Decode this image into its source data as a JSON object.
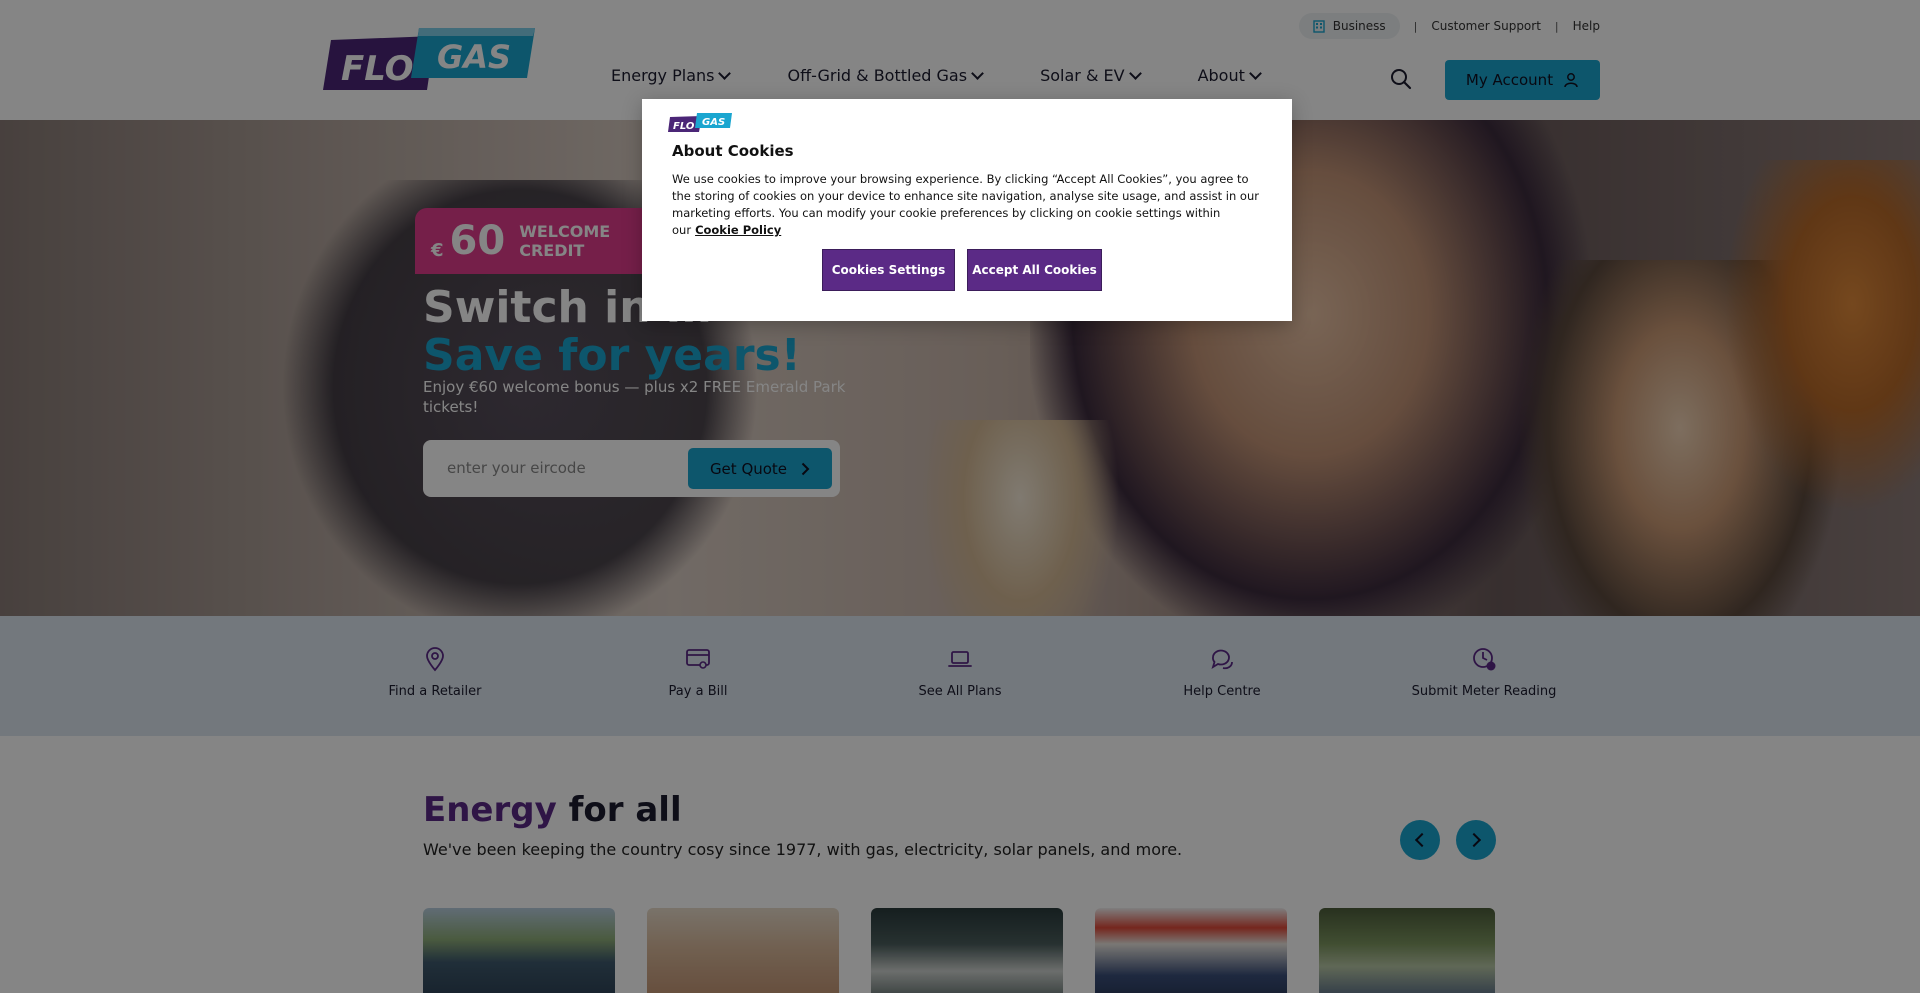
{
  "header": {
    "logo_text_left": "FLO",
    "logo_text_right": "GAS",
    "utility_links": [
      "Business",
      "Customer Support",
      "Help"
    ],
    "utility_separator": "|",
    "nav": [
      {
        "label": "Energy Plans"
      },
      {
        "label": "Off-Grid & Bottled Gas"
      },
      {
        "label": "Solar & EV"
      },
      {
        "label": "About"
      }
    ],
    "account_label": "My Account"
  },
  "hero": {
    "badge_currency": "€",
    "badge_amount": "60",
    "badge_text": "WELCOME CREDIT",
    "headline_line1": "Switch in m",
    "headline_line2": "Save for years!",
    "subtext": "Enjoy €60 welcome bonus — plus x2 FREE Emerald Park tickets!",
    "input_placeholder": "enter your eircode",
    "quote_button": "Get Quote"
  },
  "quick_links": [
    {
      "label": "Find a Retailer",
      "icon": "map-pin-icon"
    },
    {
      "label": "Pay a Bill",
      "icon": "bill-icon"
    },
    {
      "label": "See All Plans",
      "icon": "laptop-icon"
    },
    {
      "label": "Help Centre",
      "icon": "chat-icon"
    },
    {
      "label": "Submit Meter Reading",
      "icon": "meter-icon"
    }
  ],
  "energy_section": {
    "title_accent": "Energy",
    "title_rest": " for all",
    "subtitle": "We've been keeping the country cosy since 1977, with gas, electricity, solar panels, and more."
  },
  "cookie_modal": {
    "title": "About Cookies",
    "body": "We use cookies to improve your browsing experience. By clicking “Accept All Cookies”, you agree to the storing of cookies on your device to enhance site navigation, analyse site usage, and assist in our marketing efforts. You can modify your cookie preferences by clicking on cookie settings within our",
    "policy_link": "Cookie Policy",
    "settings_button": "Cookies Settings",
    "accept_button": "Accept All Cookies"
  },
  "colors": {
    "brand_purple": "#5b2a86",
    "brand_teal": "#1aa6d0",
    "badge_pink": "#e03c8d",
    "quick_links_bg": "#dde6ef"
  }
}
